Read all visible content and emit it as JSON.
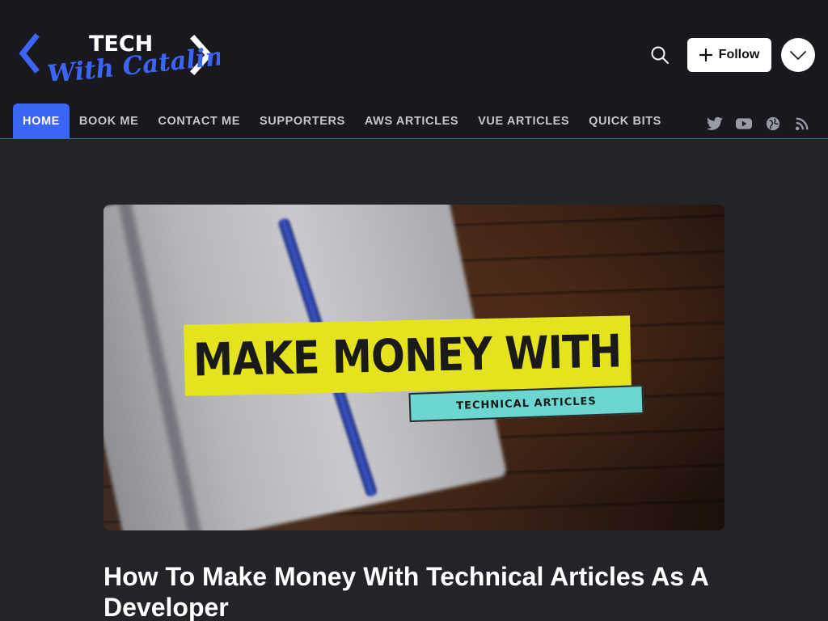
{
  "colors": {
    "accent": "#3b66f5",
    "header_bg": "#18181e",
    "page_bg": "#232428",
    "banner_yellow": "#e5e31e",
    "banner_teal": "#6cd6d0"
  },
  "brand": {
    "logo_top": "TECH",
    "logo_script": "With Catalin"
  },
  "header": {
    "search_icon": "search-icon",
    "follow_label": "Follow",
    "profile_icon": "chevron-down-icon"
  },
  "nav": {
    "items": [
      {
        "label": "HOME",
        "active": true
      },
      {
        "label": "BOOK ME"
      },
      {
        "label": "CONTACT ME"
      },
      {
        "label": "SUPPORTERS"
      },
      {
        "label": "AWS ARTICLES"
      },
      {
        "label": "VUE ARTICLES"
      },
      {
        "label": "QUICK BITS"
      }
    ]
  },
  "social": [
    "twitter-icon",
    "youtube-icon",
    "globe-icon",
    "rss-icon"
  ],
  "cover": {
    "headline": "MAKE MONEY WITH",
    "subheadline": "TECHNICAL ARTICLES"
  },
  "post": {
    "title": "How To Make Money With Technical Articles As A Developer"
  }
}
